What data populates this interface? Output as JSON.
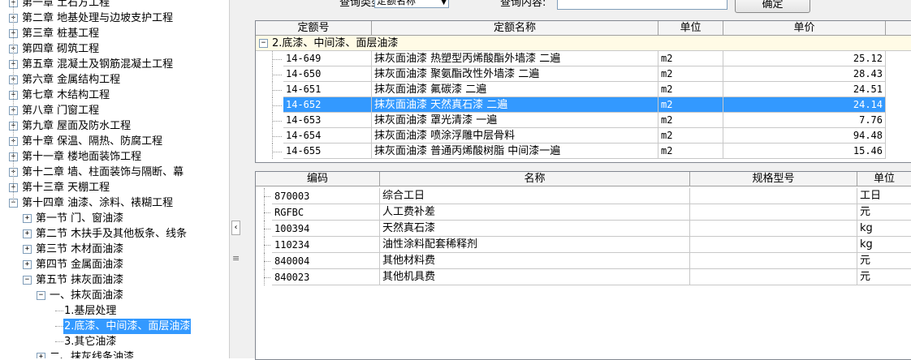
{
  "tree": {
    "items": [
      {
        "label": "第一章 土石方工程",
        "exp": "+"
      },
      {
        "label": "第二章 地基处理与边坡支护工程",
        "exp": "+"
      },
      {
        "label": "第三章 桩基工程",
        "exp": "+"
      },
      {
        "label": "第四章 砌筑工程",
        "exp": "+"
      },
      {
        "label": "第五章 混凝土及钢筋混凝土工程",
        "exp": "+"
      },
      {
        "label": "第六章 金属结构工程",
        "exp": "+"
      },
      {
        "label": "第七章 木结构工程",
        "exp": "+"
      },
      {
        "label": "第八章 门窗工程",
        "exp": "+"
      },
      {
        "label": "第九章 屋面及防水工程",
        "exp": "+"
      },
      {
        "label": "第十章 保温、隔热、防腐工程",
        "exp": "+"
      },
      {
        "label": "第十一章 楼地面装饰工程",
        "exp": "+"
      },
      {
        "label": "第十二章 墙、柱面装饰与隔断、幕",
        "exp": "+"
      },
      {
        "label": "第十三章 天棚工程",
        "exp": "+"
      },
      {
        "label": "第十四章 油漆、涂料、裱糊工程",
        "exp": "−"
      },
      {
        "label": "第一节 门、窗油漆",
        "exp": "+"
      },
      {
        "label": "第二节 木扶手及其他板条、线条",
        "exp": "+"
      },
      {
        "label": "第三节 木材面油漆",
        "exp": "+"
      },
      {
        "label": "第四节 金属面油漆",
        "exp": "+"
      },
      {
        "label": "第五节 抹灰面油漆",
        "exp": "−"
      },
      {
        "label": "一、抹灰面油漆",
        "exp": "−"
      },
      {
        "label": "1.基层处理",
        "exp": ""
      },
      {
        "label": "2.底漆、中间漆、面层油漆",
        "exp": ""
      },
      {
        "label": "3.其它油漆",
        "exp": ""
      },
      {
        "label": "二、抹灰线条油漆",
        "exp": "+"
      }
    ]
  },
  "query": {
    "type_label": "查询类型:",
    "type_value": "定额名称",
    "content_label": "查询内容:",
    "content_value": "",
    "confirm_label": "确定"
  },
  "top_grid": {
    "headers": [
      "定额号",
      "定额名称",
      "单位",
      "单价"
    ],
    "group": {
      "exp": "−",
      "label": "2.底漆、中间漆、面层油漆"
    },
    "rows": [
      {
        "code": "14-649",
        "name": "抹灰面油漆 热塑型丙烯酸酯外墙漆 二遍",
        "unit": "m2",
        "price": "25.12"
      },
      {
        "code": "14-650",
        "name": "抹灰面油漆 聚氨酯改性外墙漆 二遍",
        "unit": "m2",
        "price": "28.43"
      },
      {
        "code": "14-651",
        "name": "抹灰面油漆 氟碳漆 二遍",
        "unit": "m2",
        "price": "24.51"
      },
      {
        "code": "14-652",
        "name": "抹灰面油漆 天然真石漆 二遍",
        "unit": "m2",
        "price": "24.14"
      },
      {
        "code": "14-653",
        "name": "抹灰面油漆 罩光清漆 一遍",
        "unit": "m2",
        "price": "7.76"
      },
      {
        "code": "14-654",
        "name": "抹灰面油漆 喷涂浮雕中层骨料",
        "unit": "m2",
        "price": "94.48"
      },
      {
        "code": "14-655",
        "name": "抹灰面油漆 普通丙烯酸树脂 中间漆一遍",
        "unit": "m2",
        "price": "15.46"
      }
    ]
  },
  "bottom_grid": {
    "headers": [
      "编码",
      "名称",
      "规格型号",
      "单位"
    ],
    "rows": [
      {
        "code": "870003",
        "name": "综合工日",
        "spec": "",
        "unit": "工日"
      },
      {
        "code": "RGFBC",
        "name": "人工费补差",
        "spec": "",
        "unit": "元"
      },
      {
        "code": "100394",
        "name": "天然真石漆",
        "spec": "",
        "unit": "kg"
      },
      {
        "code": "110234",
        "name": "油性涂料配套稀释剂",
        "spec": "",
        "unit": "kg"
      },
      {
        "code": "840004",
        "name": "其他材料费",
        "spec": "",
        "unit": "元"
      },
      {
        "code": "840023",
        "name": "其他机具费",
        "spec": "",
        "unit": "元"
      }
    ]
  },
  "splitter": {
    "arrow": "‹",
    "grip": "≡"
  }
}
